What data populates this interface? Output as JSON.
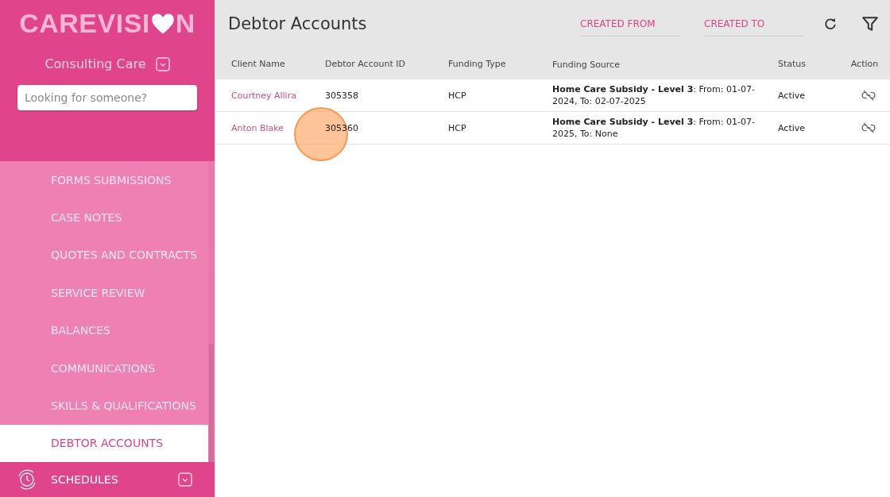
{
  "sidebar": {
    "logo": [
      "CAREVISI",
      "N"
    ],
    "org": "Consulting Care",
    "search": {
      "placeholder": "Looking for someone?"
    },
    "items": [
      {
        "label": "FORMS SUBMISSIONS",
        "selected": false
      },
      {
        "label": "CASE NOTES",
        "selected": false
      },
      {
        "label": "QUOTES AND CONTRACTS",
        "selected": false
      },
      {
        "label": "SERVICE REVIEW",
        "selected": false
      },
      {
        "label": "BALANCES",
        "selected": false
      },
      {
        "label": "COMMUNICATIONS",
        "selected": false
      },
      {
        "label": "SKILLS & QUALIFICATIONS",
        "selected": false
      },
      {
        "label": "DEBTOR ACCOUNTS",
        "selected": true
      }
    ],
    "section": {
      "label": "SCHEDULES",
      "expanded": false
    }
  },
  "page": {
    "title": "Debtor Accounts",
    "filters": [
      {
        "placeholder": "CREATED FROM"
      },
      {
        "placeholder": "CREATED TO"
      }
    ]
  },
  "table": {
    "columns": [
      "Client Name",
      "Debtor Account ID",
      "Funding Type",
      "Funding Source",
      "Status",
      "Action"
    ],
    "rows": [
      {
        "client": "Courtney Allira",
        "id": "305358",
        "type": "HCP",
        "source": "**Home Care Subsidy - Level 3**: From: 01-07-2024, To: 02-07-2025",
        "status": "Active",
        "clicked": false
      },
      {
        "client": "Anton Blake",
        "id": "305360",
        "type": "HCP",
        "source": "**Home Care Subsidy - Level 3**: From: 01-07-2025, To: None",
        "status": "Active",
        "clicked": true
      }
    ]
  }
}
